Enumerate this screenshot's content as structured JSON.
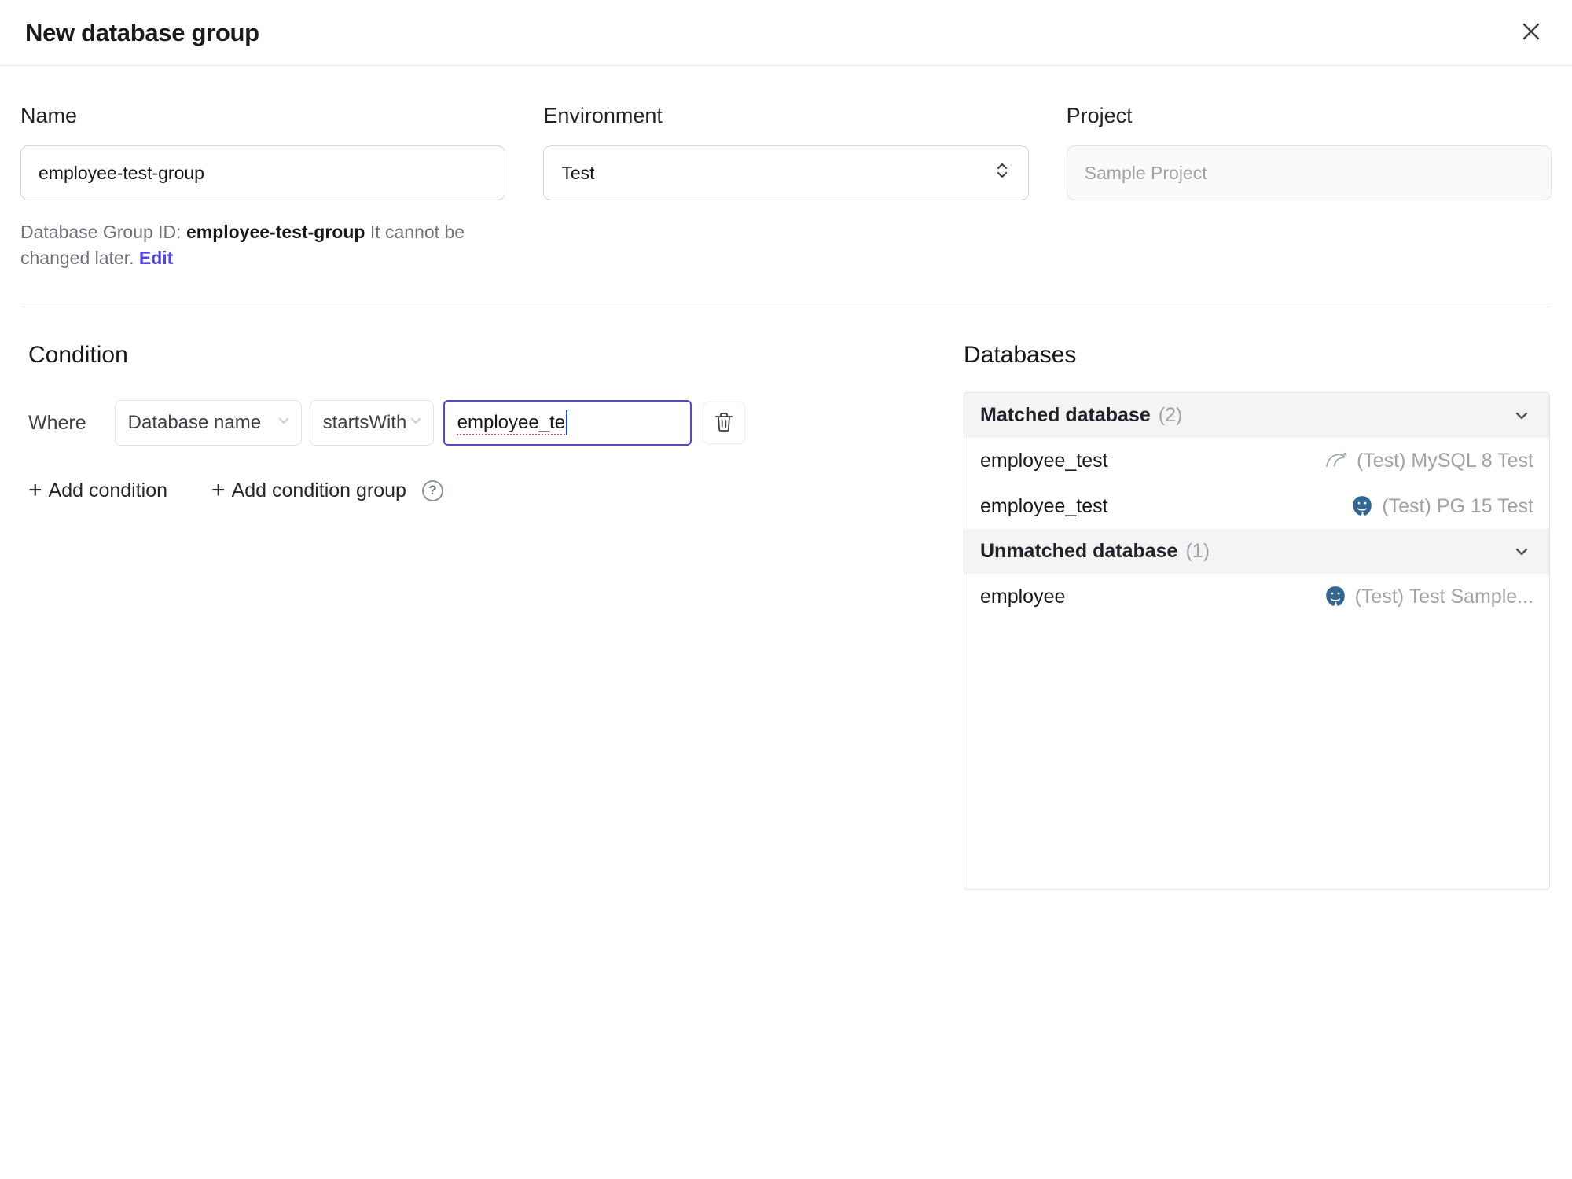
{
  "dialog": {
    "title": "New database group"
  },
  "form": {
    "name": {
      "label": "Name",
      "value": "employee-test-group"
    },
    "environment": {
      "label": "Environment",
      "value": "Test"
    },
    "project": {
      "label": "Project",
      "value": "Sample Project"
    },
    "group_id_note": {
      "prefix": "Database Group ID: ",
      "id": "employee-test-group",
      "suffix": " It cannot be changed later. ",
      "edit_label": "Edit"
    }
  },
  "condition": {
    "heading": "Condition",
    "where_label": "Where",
    "field": "Database name",
    "operator": "startsWith",
    "value": "employee_te",
    "add_condition_label": "Add condition",
    "add_condition_group_label": "Add condition group",
    "help_glyph": "?"
  },
  "databases": {
    "heading": "Databases",
    "matched": {
      "label": "Matched database",
      "count": "(2)",
      "rows": [
        {
          "name": "employee_test",
          "engine": "mysql",
          "instance": "(Test) MySQL 8 Test"
        },
        {
          "name": "employee_test",
          "engine": "postgres",
          "instance": "(Test) PG 15 Test"
        }
      ]
    },
    "unmatched": {
      "label": "Unmatched database",
      "count": "(1)",
      "rows": [
        {
          "name": "employee",
          "engine": "postgres",
          "instance": "(Test) Test Sample..."
        }
      ]
    }
  },
  "colors": {
    "accent": "#4f46e5",
    "focus_border": "#4f46e5",
    "spellcheck_underline": "#e05252",
    "postgres_blue": "#336791",
    "muted_text": "#a1a1aa"
  }
}
